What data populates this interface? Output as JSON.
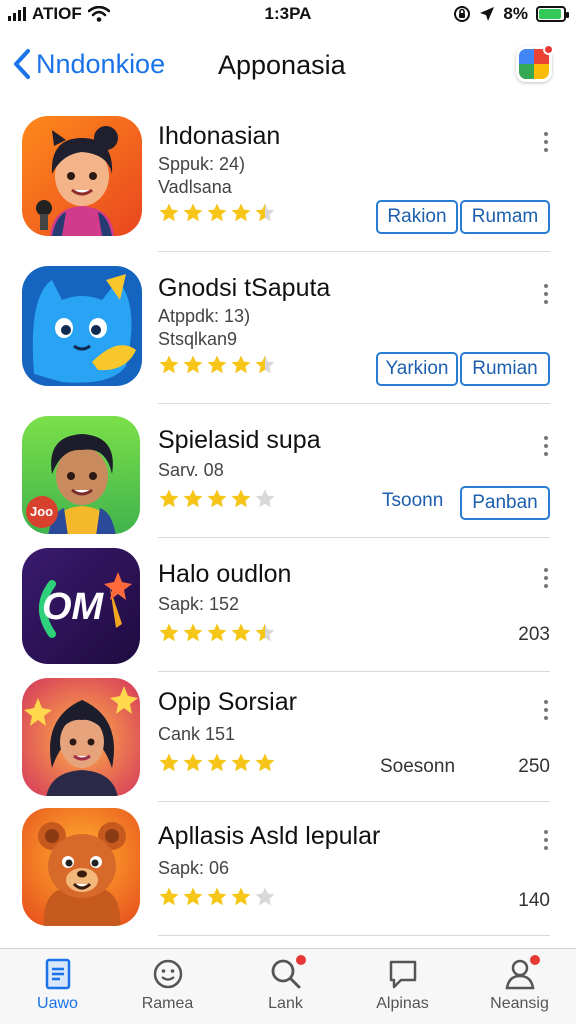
{
  "status_bar": {
    "carrier": "ATIOF",
    "time": "1:3PA",
    "battery": "8%",
    "battery_level": 0.9
  },
  "nav": {
    "back_label": "Nndonkioe",
    "title": "Apponasia"
  },
  "apps": [
    {
      "title": "Ihdonasian",
      "line1": "Sppuk: 24)",
      "line2": "Vadlsana",
      "rating": 4.5,
      "buttons": [
        "Rakion",
        "Rumam"
      ],
      "icon": "girl-avatar-icon"
    },
    {
      "title": "Gnodsi tSaputa",
      "line1": "Atppdk: 13)",
      "line2": "Stsqlkan9",
      "rating": 4.5,
      "buttons": [
        "Yarkion",
        "Rumian"
      ],
      "icon": "blue-cat-icon"
    },
    {
      "title": "Spielasid supa",
      "line1": "Sarv. 08",
      "rating": 4,
      "plain_text": "Tsoonn",
      "buttons": [
        "Panban"
      ],
      "icon": "boy-avatar-icon",
      "icon_badge": "Joo"
    },
    {
      "title": "Halo oudlon",
      "line1": "Sapk: 152",
      "rating": 4.5,
      "right_value": "203",
      "icon": "om-logo-icon",
      "icon_text": "OM"
    },
    {
      "title": "Opip Sorsiar",
      "line1": "Cank 151",
      "rating": 5,
      "plain_text": "Soesonn",
      "right_value": "250",
      "icon": "woman-avatar-icon"
    },
    {
      "title": "Apllasis Asld lepular",
      "line1": "Sapk: 06",
      "rating": 4,
      "right_value": "140",
      "icon": "bear-icon"
    }
  ],
  "tabs": [
    {
      "label": "Uawo",
      "icon": "document-icon",
      "active": true
    },
    {
      "label": "Ramea",
      "icon": "smiley-icon",
      "active": false
    },
    {
      "label": "Lank",
      "icon": "search-icon",
      "active": false,
      "badge": true
    },
    {
      "label": "Alpinas",
      "icon": "chat-bubble-icon",
      "active": false
    },
    {
      "label": "Neansig",
      "icon": "person-icon",
      "active": false,
      "badge": true
    }
  ],
  "colors": {
    "accent": "#1a73e8",
    "button_border": "#2a7bd3",
    "star": "#f5c518",
    "star_empty": "#d8d8d8"
  }
}
